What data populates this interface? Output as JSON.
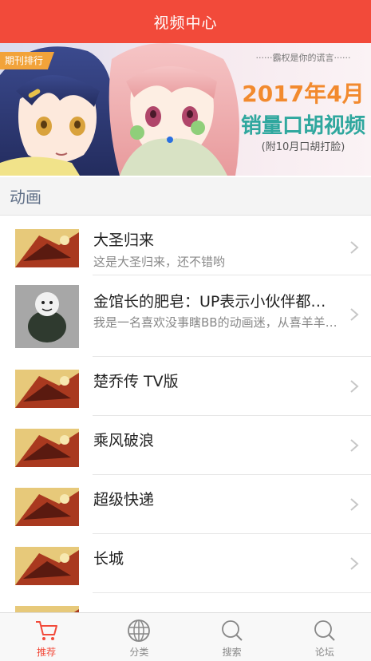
{
  "header": {
    "title": "视频中心"
  },
  "banner": {
    "badge": "期刊排行",
    "tagline": "······霸权是你的谎言······",
    "headline": "2017年4月",
    "subline": "销量口胡视频",
    "note": "(附10月口胡打脸)"
  },
  "section": {
    "title": "动画"
  },
  "list": [
    {
      "title": "大圣归来",
      "subtitle": "这是大圣归来，还不错哟"
    },
    {
      "title": "金馆长的肥皂：UP表示小伙伴都惊呆了",
      "subtitle": "我是一名喜欢没事瞎BB的动画迷，从喜羊羊到海贼王"
    },
    {
      "title": "楚乔传 TV版"
    },
    {
      "title": "乘风破浪"
    },
    {
      "title": "超级快递"
    },
    {
      "title": "长城"
    },
    {
      "title": ""
    }
  ],
  "tabbar": {
    "items": [
      {
        "label": "推荐",
        "icon": "cart-icon",
        "active": true
      },
      {
        "label": "分类",
        "icon": "globe-icon"
      },
      {
        "label": "搜索",
        "icon": "search-icon"
      },
      {
        "label": "论坛",
        "icon": "search-icon"
      }
    ]
  },
  "colors": {
    "accent": "#f24a3a",
    "section_text": "#5f6f87",
    "inactive_tab": "#888888"
  }
}
